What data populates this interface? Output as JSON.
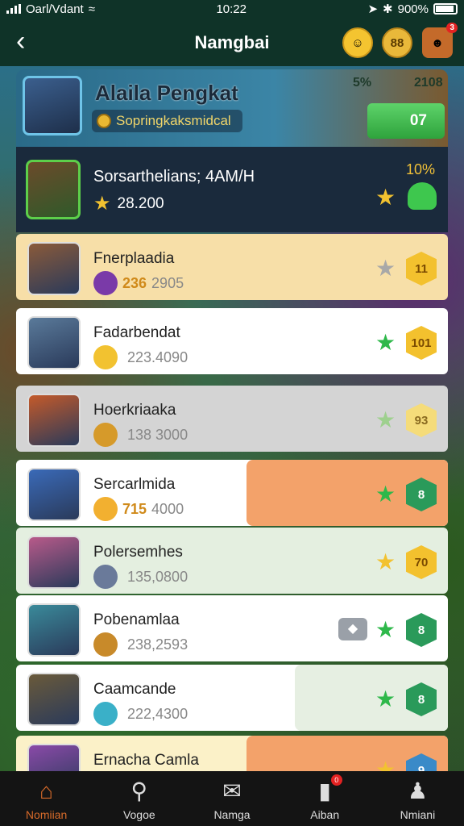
{
  "status_bar": {
    "carrier": "Oarl/Vdant",
    "time": "10:22",
    "battery": "900%"
  },
  "header": {
    "title": "Namgbai",
    "btn2_label": "88",
    "notification_count": "3"
  },
  "banner": {
    "name": "Alaila Pengkat",
    "subtitle": "Sopringkaksmidcal",
    "stat1": "5%",
    "stat2": "2108",
    "button_label": "07"
  },
  "featured": {
    "title": "Sorsarthelians; 4AM/H",
    "score": "28.200",
    "percent": "10%"
  },
  "rows": [
    {
      "name": "Fnerplaadia",
      "score_hl": "236",
      "score": "2905",
      "badge": "11",
      "bg": "#f7dfa8",
      "fill": "",
      "fill_color": "",
      "star_color": "#a8a8a8",
      "badge_color": "#f3c12e",
      "badge_text": "#7a4a00",
      "hl_color": "#d08a1a",
      "gem": "#7a3aa8",
      "av": "#8a5a3a"
    },
    {
      "name": "Fadarbendat",
      "score_hl": "",
      "score": "223.4090",
      "badge": "101",
      "bg": "#ffffff",
      "fill": "",
      "fill_color": "",
      "star_color": "#2eb84a",
      "badge_color": "#f3c12e",
      "badge_text": "#7a4a00",
      "hl_color": "#888",
      "gem": "#f2c230",
      "av": "#5a7a9a"
    },
    {
      "name": "Hoerkriaaka",
      "score_hl": "",
      "score": "138 3000",
      "badge": "93",
      "bg": "#d4d4d4",
      "fill": "",
      "fill_color": "",
      "star_color": "#9ed08e",
      "badge_color": "#f5dc7a",
      "badge_text": "#8a6a20",
      "hl_color": "#888",
      "gem": "#d69a2a",
      "av": "#c45a2a"
    },
    {
      "name": "Sercarlmida",
      "score_hl": "715",
      "score": "4000",
      "badge": "8",
      "bg": "#ffffff",
      "fill": "right",
      "fill_color": "#f3a26a",
      "star_color": "#2eb84a",
      "badge_color": "#2a9a5a",
      "badge_text": "#fff",
      "hl_color": "#d08a1a",
      "gem": "#f2b030",
      "av": "#3a6ab8"
    },
    {
      "name": "Polersemhes",
      "score_hl": "",
      "score": "135,0800",
      "badge": "70",
      "bg": "#e4efe0",
      "fill": "",
      "fill_color": "",
      "star_color": "#f2c230",
      "badge_color": "#f3c12e",
      "badge_text": "#7a4a00",
      "hl_color": "#888",
      "gem": "#6a7a9a",
      "av": "#b85a8a"
    },
    {
      "name": "Pobenamlaa",
      "score_hl": "",
      "score": "238,2593",
      "badge": "8",
      "bg": "#ffffff",
      "fill": "",
      "fill_color": "",
      "star_color": "#2eb84a",
      "badge_color": "#2a9a5a",
      "badge_text": "#fff",
      "hl_color": "#888",
      "gem": "#c88a2a",
      "av": "#3a8a9a",
      "tag": "◆"
    },
    {
      "name": "Caamcande",
      "score_hl": "",
      "score": "222,4300",
      "badge": "8",
      "bg": "#ffffff",
      "fill": "right-pale",
      "fill_color": "#e6efe2",
      "star_color": "#2eb84a",
      "badge_color": "#2a9a5a",
      "badge_text": "#fff",
      "hl_color": "#888",
      "gem": "#3ab0c8",
      "av": "#6a5a3a"
    },
    {
      "name": "Ernacha Camla",
      "score_hl": "",
      "score": "",
      "badge": "9",
      "bg": "#fbf1c8",
      "fill": "right",
      "fill_color": "#f3a26a",
      "star_color": "#f2c230",
      "badge_color": "#3a8ac8",
      "badge_text": "#fff",
      "hl_color": "#888",
      "gem": "#c88a2a",
      "av": "#8a4aa8"
    }
  ],
  "nav": {
    "items": [
      {
        "label": "Nomiian",
        "icon": "home-icon"
      },
      {
        "label": "Vogoe",
        "icon": "search-icon"
      },
      {
        "label": "Namga",
        "icon": "mail-icon"
      },
      {
        "label": "Aiban",
        "icon": "cards-icon"
      },
      {
        "label": "Nmiani",
        "icon": "user-icon"
      }
    ],
    "badge": "0"
  },
  "colors": {
    "header_bg": "#0f3328",
    "accent_green": "#2eb84a",
    "accent_orange": "#d86b2a",
    "gold": "#f3c12e"
  }
}
